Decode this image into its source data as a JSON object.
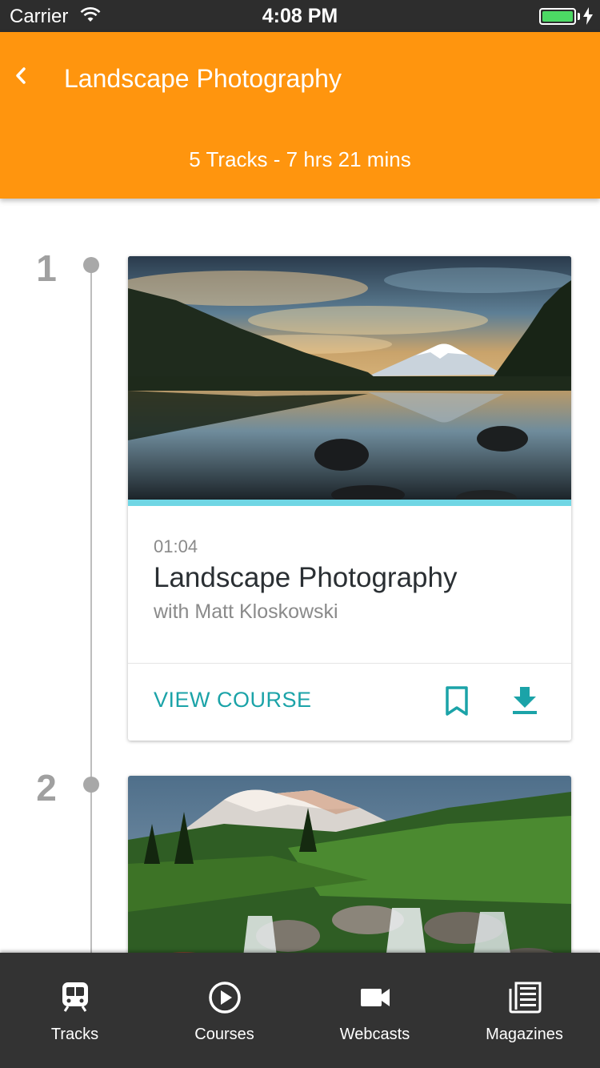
{
  "status_bar": {
    "carrier": "Carrier",
    "time": "4:08 PM",
    "battery_level": 1.0,
    "battery_color": "#4cd964"
  },
  "header": {
    "back_icon": "chevron-left-icon",
    "title": "Landscape Photography",
    "subtitle": "5 Tracks - 7 hrs 21 mins",
    "background_color": "#ff950e"
  },
  "tracks": [
    {
      "number": "1",
      "image": "mountain-lake-reflection-photo",
      "progress": 1.0,
      "duration": "01:04",
      "title": "Landscape Photography",
      "author": "with Matt Kloskowski",
      "action_label": "VIEW COURSE",
      "bookmark_icon": "bookmark-icon",
      "download_icon": "download-icon"
    },
    {
      "number": "2",
      "image": "mountain-waterfall-meadow-photo"
    }
  ],
  "accent_color": "#1ba3a8",
  "tab_bar": {
    "items": [
      {
        "label": "Tracks",
        "icon": "train-icon"
      },
      {
        "label": "Courses",
        "icon": "play-circle-icon"
      },
      {
        "label": "Webcasts",
        "icon": "video-camera-icon"
      },
      {
        "label": "Magazines",
        "icon": "newspaper-icon"
      }
    ]
  }
}
